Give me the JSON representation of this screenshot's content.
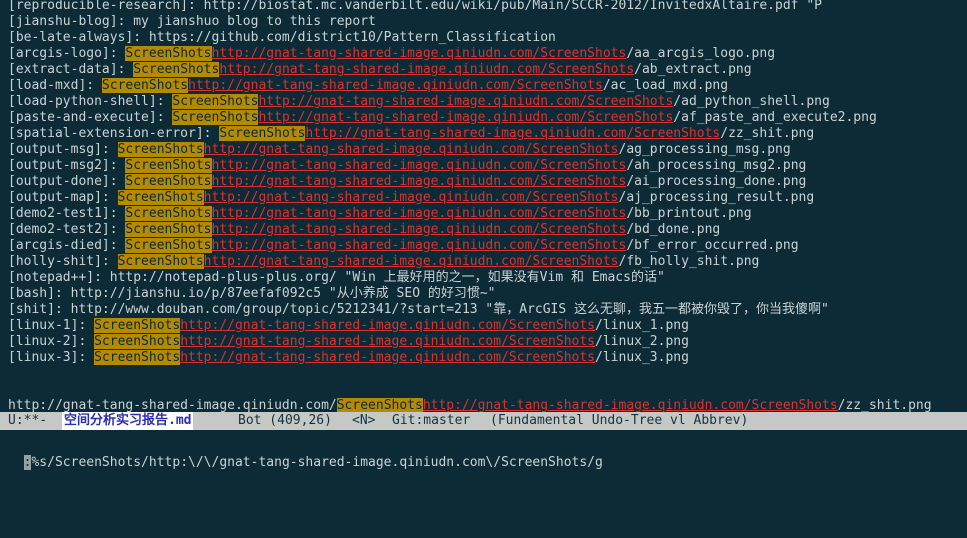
{
  "buffer": {
    "lines": [
      {
        "text": "[reproducible-research]: http://biostat.mc.vanderbilt.edu/wiki/pub/Main/SCCR-2012/InvitedxAltaire.pdf \"P"
      },
      {
        "text": "[jianshu-blog]: my jianshuo blog to this report"
      },
      {
        "text": "[be-late-always]: https://github.com/district10/Pattern_Classification"
      },
      {
        "prefix": "[arcgis-logo]: ",
        "tag": "ScreenShots",
        "url": "http://gnat-tang-shared-image.qiniudn.com/ScreenShots",
        "suffix": "/aa_arcgis_logo.png"
      },
      {
        "prefix": "[extract-data]: ",
        "tag": "ScreenShots",
        "url": "http://gnat-tang-shared-image.qiniudn.com/ScreenShots",
        "suffix": "/ab_extract.png"
      },
      {
        "prefix": "[load-mxd]: ",
        "tag": "ScreenShots",
        "url": "http://gnat-tang-shared-image.qiniudn.com/ScreenShots",
        "suffix": "/ac_load_mxd.png"
      },
      {
        "prefix": "[load-python-shell]: ",
        "tag": "ScreenShots",
        "url": "http://gnat-tang-shared-image.qiniudn.com/ScreenShots",
        "suffix": "/ad_python_shell.png"
      },
      {
        "prefix": "[paste-and-execute]: ",
        "tag": "ScreenShots",
        "url": "http://gnat-tang-shared-image.qiniudn.com/ScreenShots",
        "suffix": "/af_paste_and_execute2.png"
      },
      {
        "prefix": "[spatial-extension-error]: ",
        "tag": "ScreenShots",
        "url": "http://gnat-tang-shared-image.qiniudn.com/ScreenShots",
        "suffix": "/zz_shit.png"
      },
      {
        "prefix": "[output-msg]: ",
        "tag": "ScreenShots",
        "url": "http://gnat-tang-shared-image.qiniudn.com/ScreenShots",
        "suffix": "/ag_processing_msg.png"
      },
      {
        "prefix": "[output-msg2]: ",
        "tag": "ScreenShots",
        "url": "http://gnat-tang-shared-image.qiniudn.com/ScreenShots",
        "suffix": "/ah_processing_msg2.png"
      },
      {
        "prefix": "[output-done]: ",
        "tag": "ScreenShots",
        "url": "http://gnat-tang-shared-image.qiniudn.com/ScreenShots",
        "suffix": "/ai_processing_done.png"
      },
      {
        "prefix": "[output-map]: ",
        "tag": "ScreenShots",
        "url": "http://gnat-tang-shared-image.qiniudn.com/ScreenShots",
        "suffix": "/aj_processing_result.png"
      },
      {
        "prefix": "[demo2-test1]: ",
        "tag": "ScreenShots",
        "url": "http://gnat-tang-shared-image.qiniudn.com/ScreenShots",
        "suffix": "/bb_printout.png"
      },
      {
        "prefix": "[demo2-test2]: ",
        "tag": "ScreenShots",
        "url": "http://gnat-tang-shared-image.qiniudn.com/ScreenShots",
        "suffix": "/bd_done.png"
      },
      {
        "prefix": "[arcgis-died]: ",
        "tag": "ScreenShots",
        "url": "http://gnat-tang-shared-image.qiniudn.com/ScreenShots",
        "suffix": "/bf_error_occurred.png"
      },
      {
        "prefix": "[holly-shit]: ",
        "tag": "ScreenShots",
        "url": "http://gnat-tang-shared-image.qiniudn.com/ScreenShots",
        "suffix": "/fb_holly_shit.png"
      },
      {
        "text": "[notepad++]: http://notepad-plus-plus.org/ \"Win 上最好用的之一，如果没有Vim 和 Emacs的话\""
      },
      {
        "text": "[bash]: http://jianshu.io/p/87eefaf092c5 \"从小养成 SEO 的好习惯~\""
      },
      {
        "text": "[shit]: http://www.douban.com/group/topic/5212341/?start=213 \"靠，ArcGIS 这么无聊，我五一都被你毁了，你当我傻啊\""
      },
      {
        "prefix": "[linux-1]: ",
        "tag": "ScreenShots",
        "url": "http://gnat-tang-shared-image.qiniudn.com/ScreenShots",
        "suffix": "/linux_1.png"
      },
      {
        "prefix": "[linux-2]: ",
        "tag": "ScreenShots",
        "url": "http://gnat-tang-shared-image.qiniudn.com/ScreenShots",
        "suffix": "/linux_2.png"
      },
      {
        "prefix": "[linux-3]: ",
        "tag": "ScreenShots",
        "url": "http://gnat-tang-shared-image.qiniudn.com/ScreenShots",
        "suffix": "/linux_3.png"
      },
      {
        "text": ""
      },
      {
        "text": ""
      },
      {
        "prefix": "http://gnat-tang-shared-image.qiniudn.com/",
        "tag": "ScreenShots",
        "url": "http://gnat-tang-shared-image.qiniudn.com/ScreenShots",
        "suffix": "/zz_shit.png"
      }
    ]
  },
  "modeline": {
    "status": "U:**-",
    "filename": "空间分析实习报告.md",
    "position": "Bot (409,26)",
    "evil_state": "<N>",
    "vcs": "Git:master",
    "modes": "(Fundamental Undo-Tree vl Abbrev)"
  },
  "minibuffer": {
    "cursor_char": ":",
    "command": "%s/ScreenShots/http:\\/\\/gnat-tang-shared-image.qiniudn.com\\/ScreenShots/g"
  },
  "colors": {
    "background": "#0d2b36",
    "highlight": "#b58900",
    "url": "#dc322f",
    "modeline": "#c4c9c6"
  }
}
